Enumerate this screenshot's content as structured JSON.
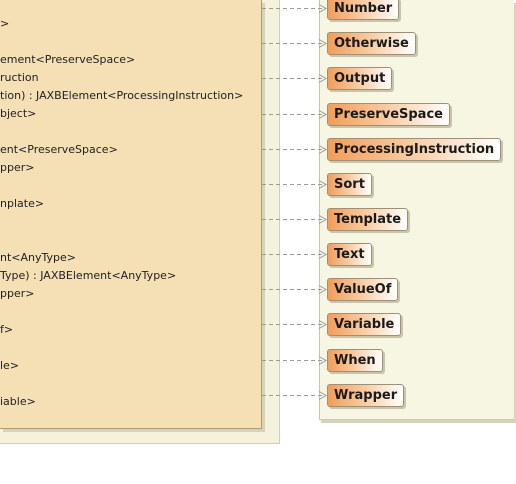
{
  "class_box": {
    "methods": [
      ">",
      "ement<PreserveSpace>",
      "ruction",
      "tion) : JAXBElement<ProcessingInstruction>",
      "bject>",
      "ent<PreserveSpace>",
      "pper>",
      "nplate>",
      "nt<AnyType>",
      "Type) : JAXBElement<AnyType>",
      "pper>",
      "f>",
      "le>",
      "iable>"
    ]
  },
  "nodes": [
    "Number",
    "Otherwise",
    "Output",
    "PreserveSpace",
    "ProcessingInstruction",
    "Sort",
    "Template",
    "Text",
    "ValueOf",
    "Variable",
    "When",
    "Wrapper"
  ],
  "colors": {
    "class_fill": "#f5dfb5",
    "node_gradient_start": "#f29d5a",
    "package_fill": "#f7f6e3",
    "connector": "#9a9a9a"
  }
}
